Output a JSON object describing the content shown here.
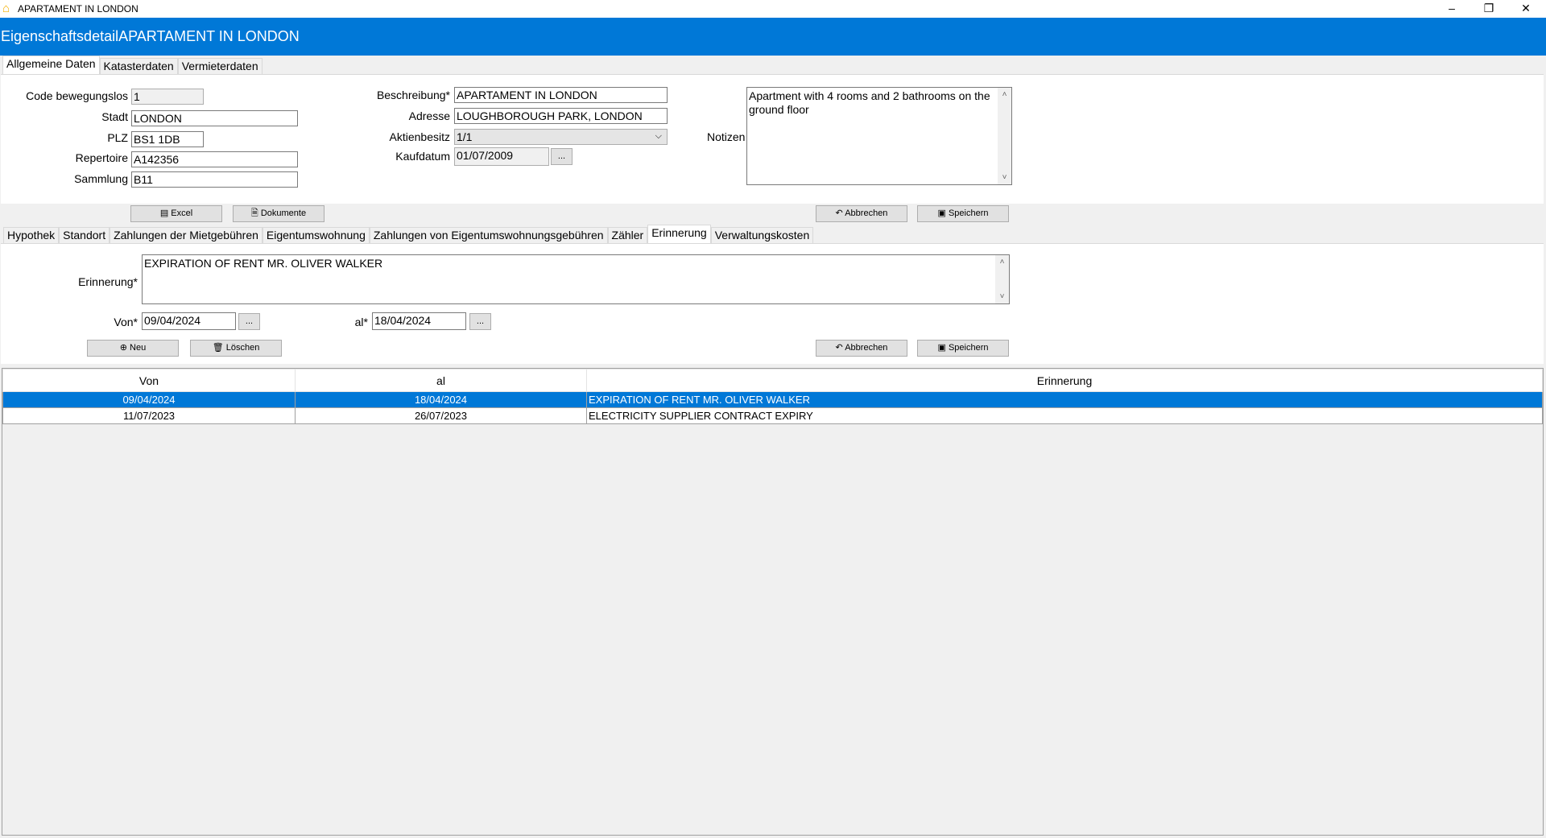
{
  "window": {
    "title": "APARTAMENT IN LONDON",
    "icon": "house-icon",
    "controls": [
      "minimize",
      "restore",
      "close"
    ]
  },
  "header": {
    "title": "EigenschaftsdetailAPARTAMENT IN LONDON",
    "color": "#0078d7"
  },
  "tabs_top": [
    {
      "label": "Allgemeine Daten",
      "active": true
    },
    {
      "label": "Katasterdaten"
    },
    {
      "label": "Vermieterdaten"
    }
  ],
  "general": {
    "code_label": "Code bewegungslos",
    "code_value": "1",
    "stadt_label": "Stadt",
    "stadt_value": "LONDON",
    "plz_label": "PLZ",
    "plz_value": "BS1 1DB",
    "repertoire_label": "Repertoire",
    "repertoire_value": "A142356",
    "sammlung_label": "Sammlung",
    "sammlung_value": "B11",
    "beschreibung_label": "Beschreibung*",
    "beschreibung_value": "APARTAMENT IN LONDON",
    "adresse_label": "Adresse",
    "adresse_value": "LOUGHBOROUGH PARK, LONDON",
    "aktienbesitz_label": "Aktienbesitz",
    "aktienbesitz_value": "1/1",
    "kaufdatum_label": "Kaufdatum",
    "kaufdatum_value": "01/07/2009",
    "notizen_label": "Notizen",
    "notizen_value": "Apartment with 4 rooms and 2 bathrooms on the ground floor",
    "picker_label": "...",
    "excel_label": "Excel",
    "dokumente_label": "Dokumente",
    "abbrechen_label": "Abbrechen",
    "speichern_label": "Speichern"
  },
  "tabs_bottom": [
    {
      "label": "Hypothek"
    },
    {
      "label": "Standort"
    },
    {
      "label": "Zahlungen der Mietgebühren"
    },
    {
      "label": "Eigentumswohnung"
    },
    {
      "label": "Zahlungen von Eigentumswohnungsgebühren"
    },
    {
      "label": "Zähler"
    },
    {
      "label": "Erinnerung",
      "active": true
    },
    {
      "label": "Verwaltungskosten"
    }
  ],
  "reminder": {
    "erinnerung_label": "Erinnerung*",
    "erinnerung_value": "EXPIRATION OF RENT MR. OLIVER WALKER",
    "von_label": "Von*",
    "von_value": "09/04/2024",
    "al_label": "al*",
    "al_value": "18/04/2024",
    "picker_label": "...",
    "neu_label": "Neu",
    "loeschen_label": "Löschen",
    "abbrechen_label": "Abbrechen",
    "speichern_label": "Speichern"
  },
  "table": {
    "columns": [
      "Von",
      "al",
      "Erinnerung"
    ],
    "rows": [
      {
        "von": "09/04/2024",
        "al": "18/04/2024",
        "erinnerung": "EXPIRATION OF RENT MR. OLIVER WALKER",
        "selected": true
      },
      {
        "von": "11/07/2023",
        "al": "26/07/2023",
        "erinnerung": "ELECTRICITY SUPPLIER CONTRACT EXPIRY"
      }
    ]
  }
}
